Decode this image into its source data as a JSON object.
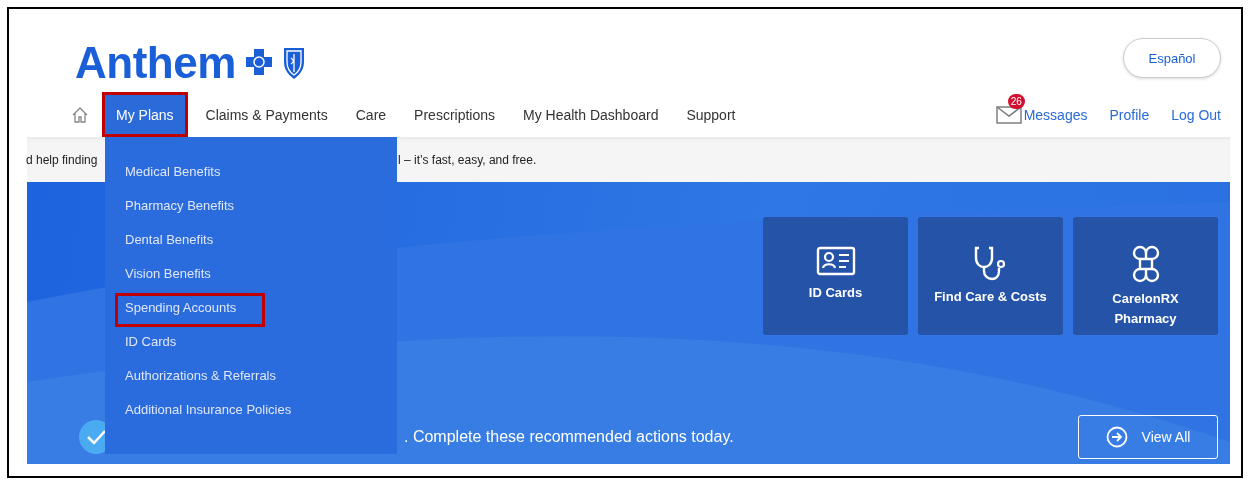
{
  "logo": {
    "text": "Anthem"
  },
  "language_button": {
    "label": "Español"
  },
  "nav": [
    {
      "kind": "home",
      "selected": false,
      "annotated": false
    },
    {
      "kind": "link",
      "label": "My Plans",
      "selected": true,
      "annotated": true
    },
    {
      "kind": "link",
      "label": "Claims & Payments",
      "selected": false,
      "annotated": false
    },
    {
      "kind": "link",
      "label": "Care",
      "selected": false,
      "annotated": false
    },
    {
      "kind": "link",
      "label": "Prescriptions",
      "selected": false,
      "annotated": false
    },
    {
      "kind": "link",
      "label": "My Health Dashboard",
      "selected": false,
      "annotated": false
    },
    {
      "kind": "link",
      "label": "Support",
      "selected": false,
      "annotated": false
    }
  ],
  "account_links": [
    {
      "kind": "messages",
      "label": "Messages",
      "badge": "26"
    },
    {
      "kind": "link",
      "label": "Profile"
    },
    {
      "kind": "link",
      "label": "Log Out"
    }
  ],
  "notice": {
    "text_before": "d help finding",
    "text_after": "l – it’s fast, easy, and free."
  },
  "dropdown": [
    {
      "label": "Medical Benefits",
      "annotated": false
    },
    {
      "label": "Pharmacy Benefits",
      "annotated": false
    },
    {
      "label": "Dental Benefits",
      "annotated": false
    },
    {
      "label": "Vision Benefits",
      "annotated": false
    },
    {
      "label": "Spending Accounts",
      "annotated": true
    },
    {
      "label": "ID Cards",
      "annotated": false
    },
    {
      "label": "Authorizations & Referrals",
      "annotated": false
    },
    {
      "label": "Additional Insurance Policies",
      "annotated": false
    }
  ],
  "quick_links": [
    {
      "kind": "id-card",
      "label": "ID Cards"
    },
    {
      "kind": "stethoscope",
      "label": "Find Care & Costs"
    },
    {
      "kind": "pharmacy",
      "label": "CarelonRX Pharmacy"
    }
  ],
  "actions": {
    "text": ". Complete these recommended actions today.",
    "button": "View All"
  }
}
